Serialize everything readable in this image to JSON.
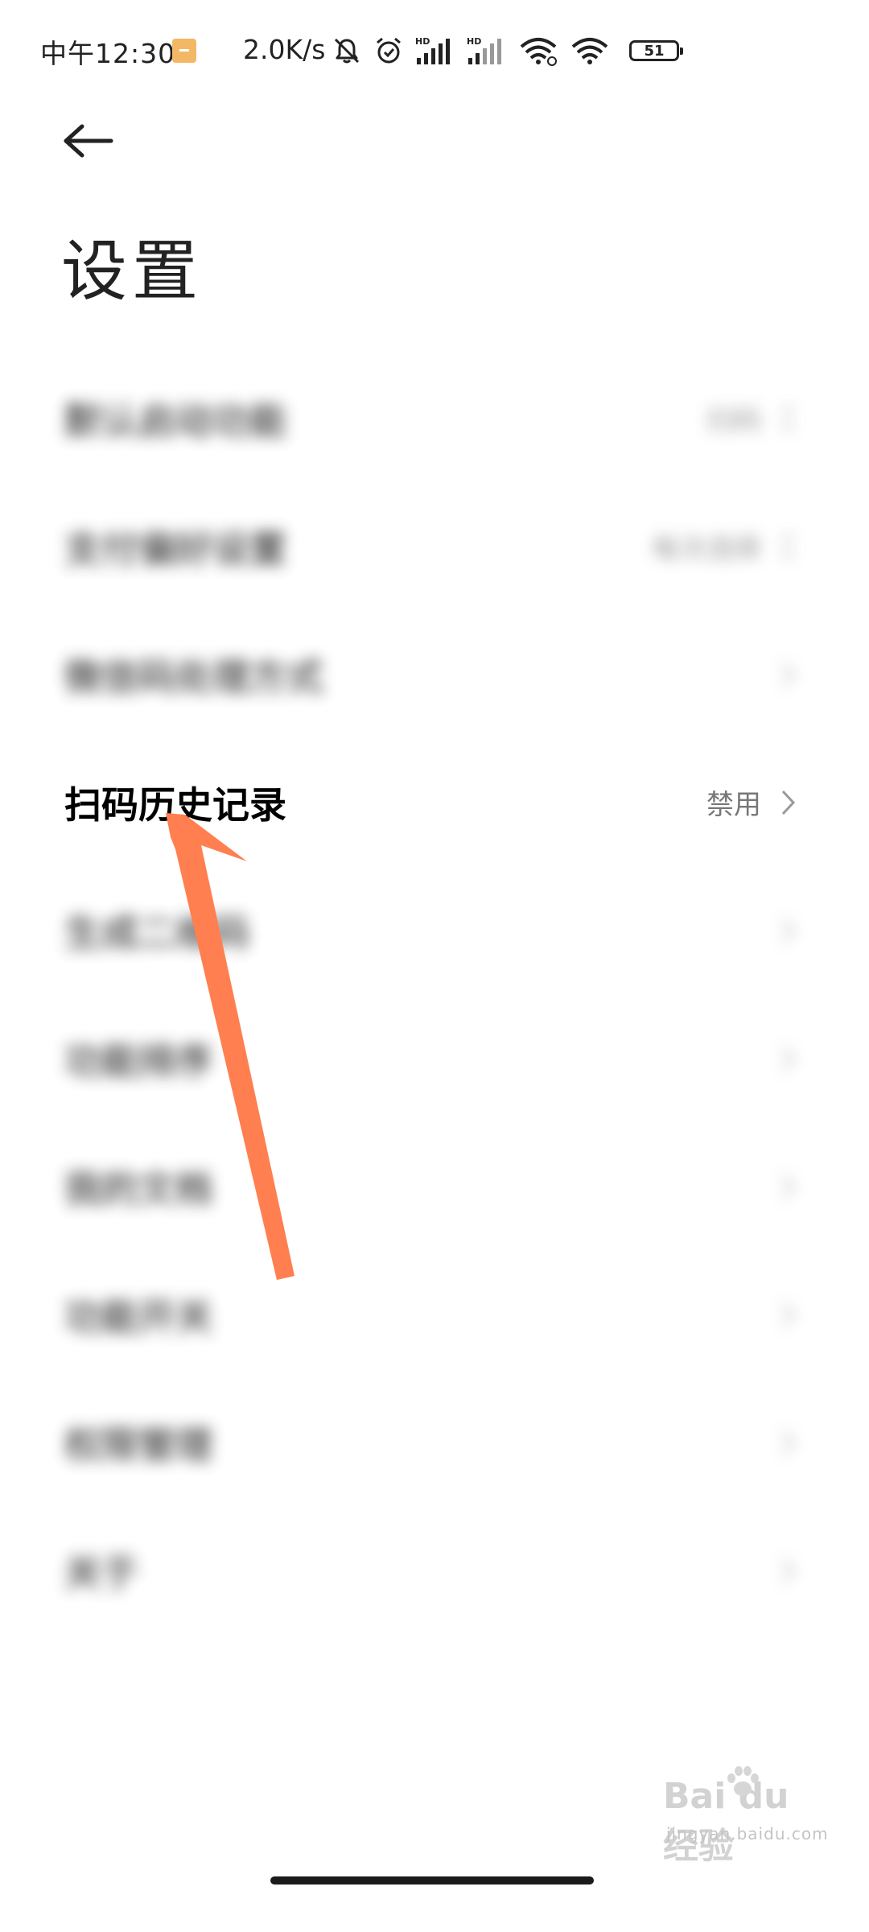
{
  "status_bar": {
    "time": "中午12:30",
    "net_speed": "2.0K/s",
    "battery": "51",
    "signal1_label": "HD",
    "signal2_label": "HD",
    "icons": [
      "notification-icon",
      "mute-bell-icon",
      "alarm-icon",
      "signal-hd-icon",
      "signal-hd-icon",
      "wifi-icon",
      "wifi-icon",
      "battery-icon"
    ]
  },
  "header": {
    "back_icon": "back-arrow-icon",
    "title": "设置"
  },
  "settings": {
    "items": [
      {
        "label": "默认启动功能",
        "value": "扫码"
      },
      {
        "label": "支付偏好设置",
        "value": "每次选择"
      },
      {
        "label": "微信码处理方式",
        "value": ""
      },
      {
        "label": "扫码历史记录",
        "value": "禁用"
      },
      {
        "label": "生成二维码",
        "value": ""
      },
      {
        "label": "功能排序",
        "value": ""
      },
      {
        "label": "我的文档",
        "value": ""
      },
      {
        "label": "功能开关",
        "value": ""
      },
      {
        "label": "权限管理",
        "value": ""
      },
      {
        "label": "关于",
        "value": ""
      }
    ]
  },
  "annotation": {
    "arrow_color": "#FF7F50",
    "points_to": "扫码历史记录"
  },
  "watermark": {
    "brand": "Bai du 经验",
    "url": "jingyan.baidu.com"
  },
  "colors": {
    "background": "#FFFFFF",
    "text_primary": "#222222",
    "text_secondary": "#777777",
    "accent_arrow": "#FF7F50"
  }
}
